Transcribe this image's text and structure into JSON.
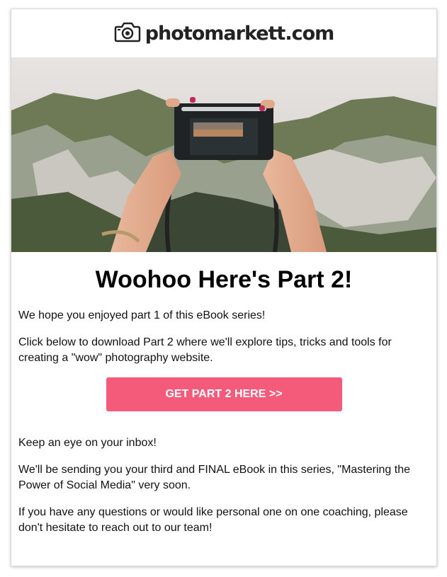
{
  "header": {
    "brand": "photomarkett.com",
    "logo_icon": "camera-icon"
  },
  "hero": {
    "image": "hands-holding-camera-over-cliffs"
  },
  "main": {
    "heading": "Woohoo Here's Part 2!",
    "intro": "We hope you enjoyed part 1 of this eBook series!",
    "download_text": "Click below to download Part 2 where we'll explore tips, tricks and tools for creating a \"wow\" photography website.",
    "cta_label": "GET PART 2 HERE >>",
    "inbox_text": "Keep an eye on your inbox!",
    "final_text": "We'll be sending you your third and FINAL eBook in this series, \"Mastering the Power of Social Media\" very soon.",
    "contact_text": "If you have any questions or would like personal one on one coaching, please don't hesitate to reach out to our team!"
  },
  "colors": {
    "cta_background": "#f45b7a",
    "cta_text": "#ffffff",
    "text": "#111111"
  }
}
